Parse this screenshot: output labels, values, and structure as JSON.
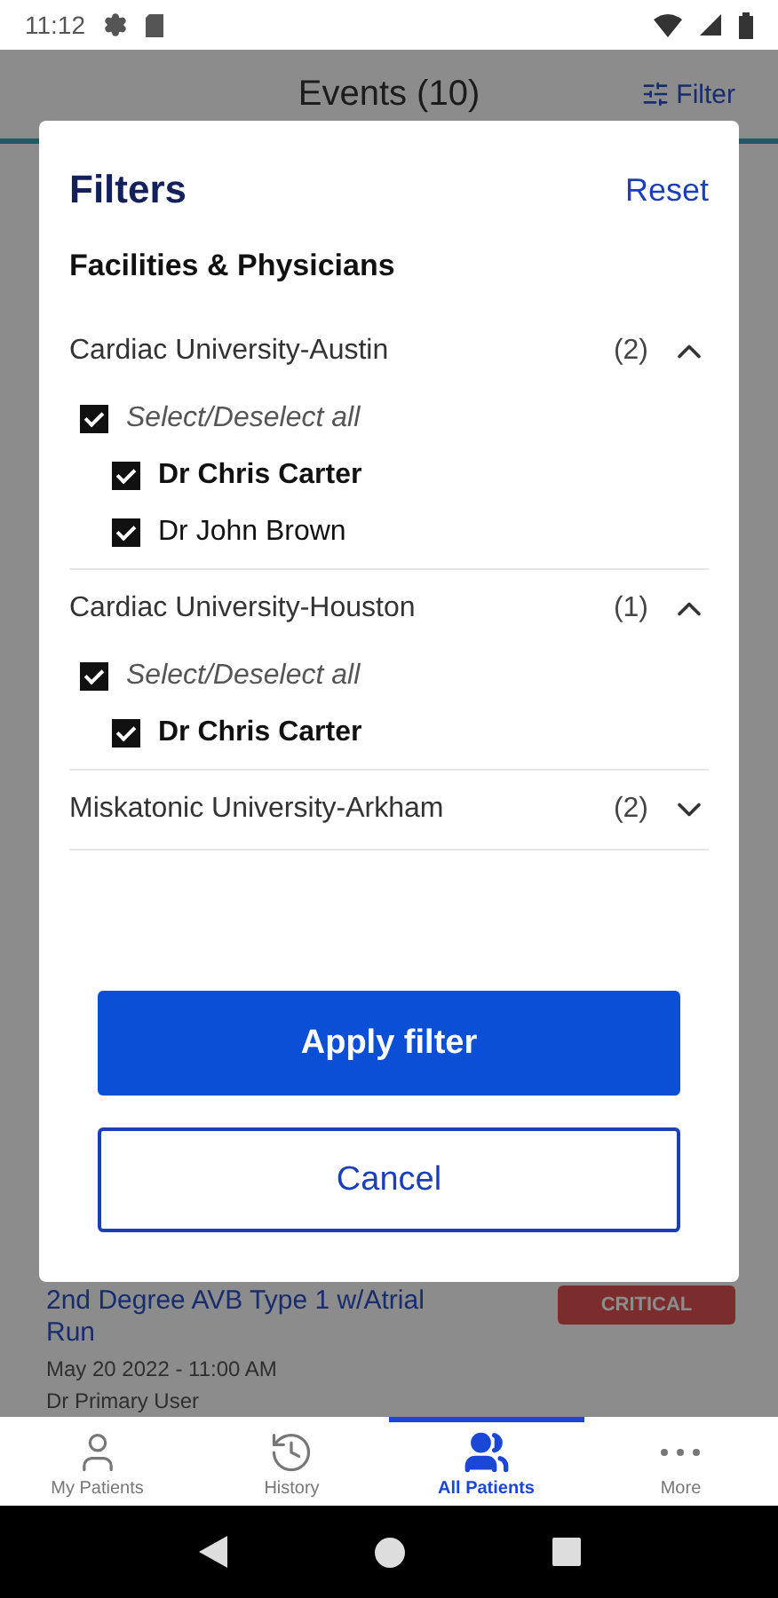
{
  "status_bar": {
    "time": "11:12"
  },
  "header": {
    "title": "Events (10)",
    "filter_label": "Filter"
  },
  "event": {
    "title": "2nd Degree AVB Type 1 w/Atrial Run",
    "time": "May 20 2022 - 11:00 AM",
    "user": "Dr Primary User",
    "badge": "CRITICAL"
  },
  "dialog": {
    "title": "Filters",
    "reset": "Reset",
    "section": "Facilities & Physicians",
    "groups": [
      {
        "name": "Cardiac University-Austin",
        "count": "(2)",
        "expanded": true,
        "select_all": {
          "label": "Select/Deselect all",
          "checked": true
        },
        "physicians": [
          {
            "name": "Dr Chris Carter",
            "checked": true,
            "primary": true
          },
          {
            "name": "Dr John Brown",
            "checked": true,
            "primary": false
          }
        ]
      },
      {
        "name": "Cardiac University-Houston",
        "count": "(1)",
        "expanded": true,
        "select_all": {
          "label": "Select/Deselect all",
          "checked": true
        },
        "physicians": [
          {
            "name": "Dr Chris Carter",
            "checked": true,
            "primary": true
          }
        ]
      },
      {
        "name": "Miskatonic University-Arkham",
        "count": "(2)",
        "expanded": false
      }
    ],
    "apply": "Apply filter",
    "cancel": "Cancel"
  },
  "nav": [
    {
      "kind": "person",
      "label": "My Patients",
      "selected": false
    },
    {
      "kind": "history",
      "label": "History",
      "selected": false
    },
    {
      "kind": "people",
      "label": "All Patients",
      "selected": true
    },
    {
      "kind": "more",
      "label": "More",
      "selected": false
    }
  ]
}
